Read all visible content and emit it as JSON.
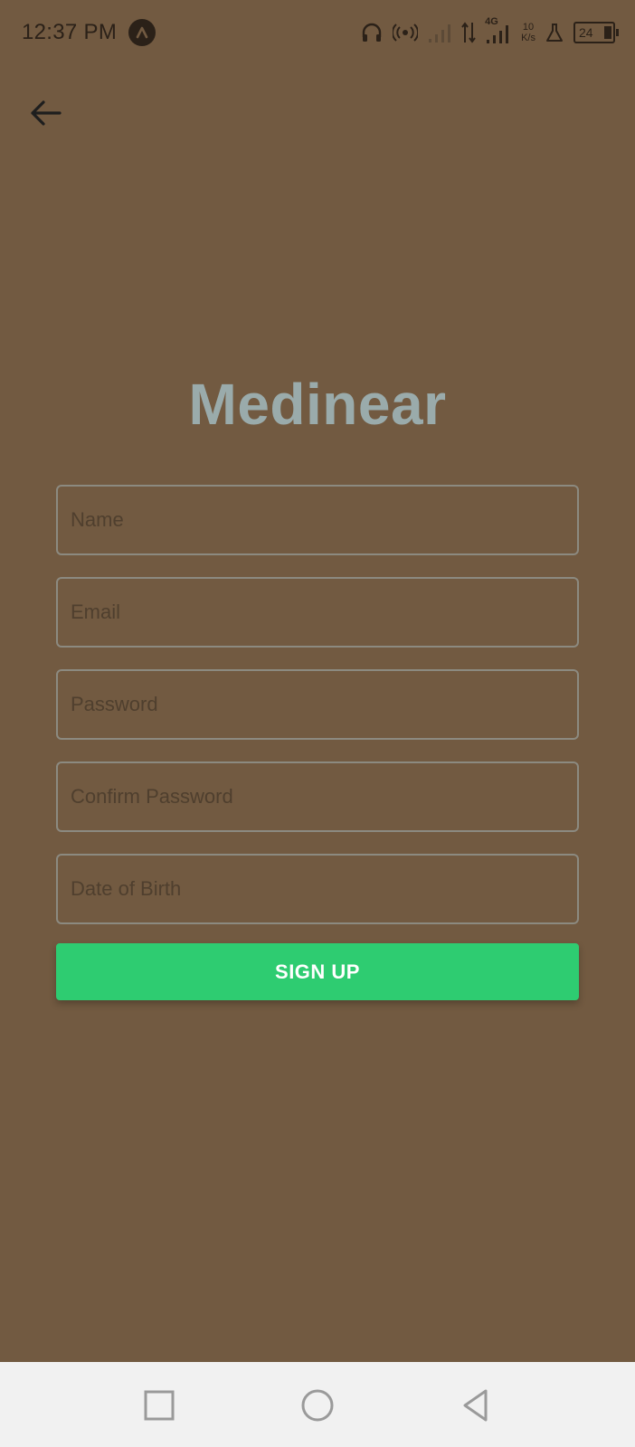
{
  "status_bar": {
    "time": "12:37 PM",
    "network_type": "4G",
    "speed_value": "10",
    "speed_unit": "K/s",
    "battery_level": "24",
    "icons": [
      "notification-app-icon",
      "headphones-icon",
      "hotspot-icon",
      "signal-icon-sim1",
      "data-transfer-icon",
      "signal-icon-sim2",
      "lab-flask-icon",
      "battery-icon"
    ]
  },
  "header": {
    "back_icon": "arrow-left-icon"
  },
  "app": {
    "title": "Medinear"
  },
  "form": {
    "name_placeholder": "Name",
    "email_placeholder": "Email",
    "password_placeholder": "Password",
    "confirm_password_placeholder": "Confirm Password",
    "dob_placeholder": "Date of Birth",
    "signup_label": "SIGN UP"
  },
  "colors": {
    "background": "#725a41",
    "title": "#9aabab",
    "button": "#2ecc71",
    "nav_bar": "#f1f1f1"
  },
  "nav_bar": {
    "buttons": [
      "recents-square-icon",
      "home-circle-icon",
      "back-triangle-icon"
    ]
  }
}
